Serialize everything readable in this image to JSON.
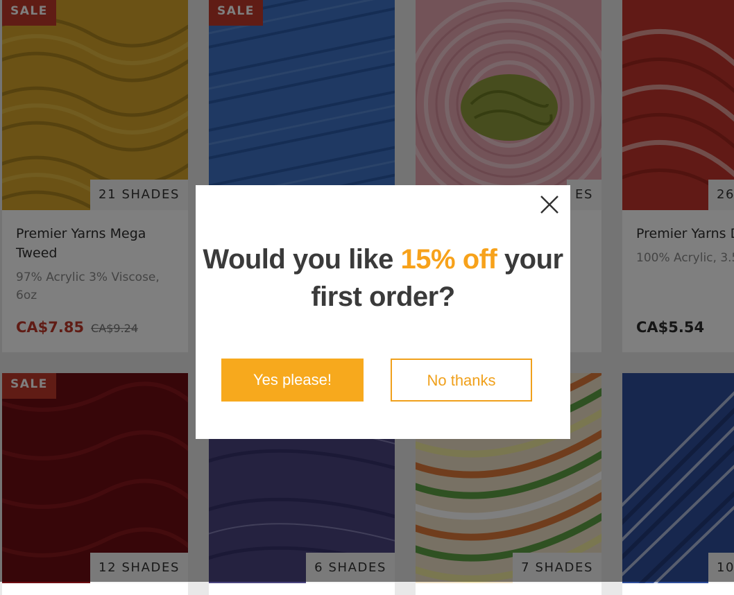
{
  "products": [
    {
      "sale_label": "SALE",
      "shades": "21 SHADES",
      "title": "Premier Yarns Mega Tweed",
      "desc": "97% Acrylic 3% Viscose, 6oz",
      "price": "CA$7.85",
      "old_price": "CA$9.24",
      "color": "#d7a52b"
    },
    {
      "sale_label": "SALE",
      "shades": "",
      "title": "",
      "desc": "",
      "price": "",
      "old_price": "",
      "color": "#3f73c6"
    },
    {
      "sale_label": "",
      "shades": "ES",
      "title": "",
      "desc": "",
      "price": "",
      "old_price": "",
      "color": "#e6a6b1"
    },
    {
      "sale_label": "",
      "shades": "26",
      "title": "Premier Yarns D Norville Everyd",
      "desc": "100% Acrylic, 3.5",
      "price": "CA$5.54",
      "old_price": "",
      "color": "#c2352c"
    },
    {
      "sale_label": "SALE",
      "shades": "12 SHADES",
      "title": "",
      "desc": "",
      "price": "",
      "old_price": "",
      "color": "#6e0d12"
    },
    {
      "sale_label": "",
      "shades": "6 SHADES",
      "title": "",
      "desc": "",
      "price": "",
      "old_price": "",
      "color": "#4b4580"
    },
    {
      "sale_label": "",
      "shades": "7 SHADES",
      "title": "",
      "desc": "",
      "price": "",
      "old_price": "",
      "color": "#e07a3b"
    },
    {
      "sale_label": "",
      "shades": "10",
      "title": "",
      "desc": "",
      "price": "",
      "old_price": "",
      "color": "#2f4f9c"
    }
  ],
  "modal": {
    "headline_pre": "Would you like ",
    "headline_highlight": "15% off",
    "headline_post": " your first order?",
    "yes_label": "Yes please!",
    "no_label": "No thanks",
    "accent": "#f7a91d",
    "close_icon": "close-icon"
  }
}
